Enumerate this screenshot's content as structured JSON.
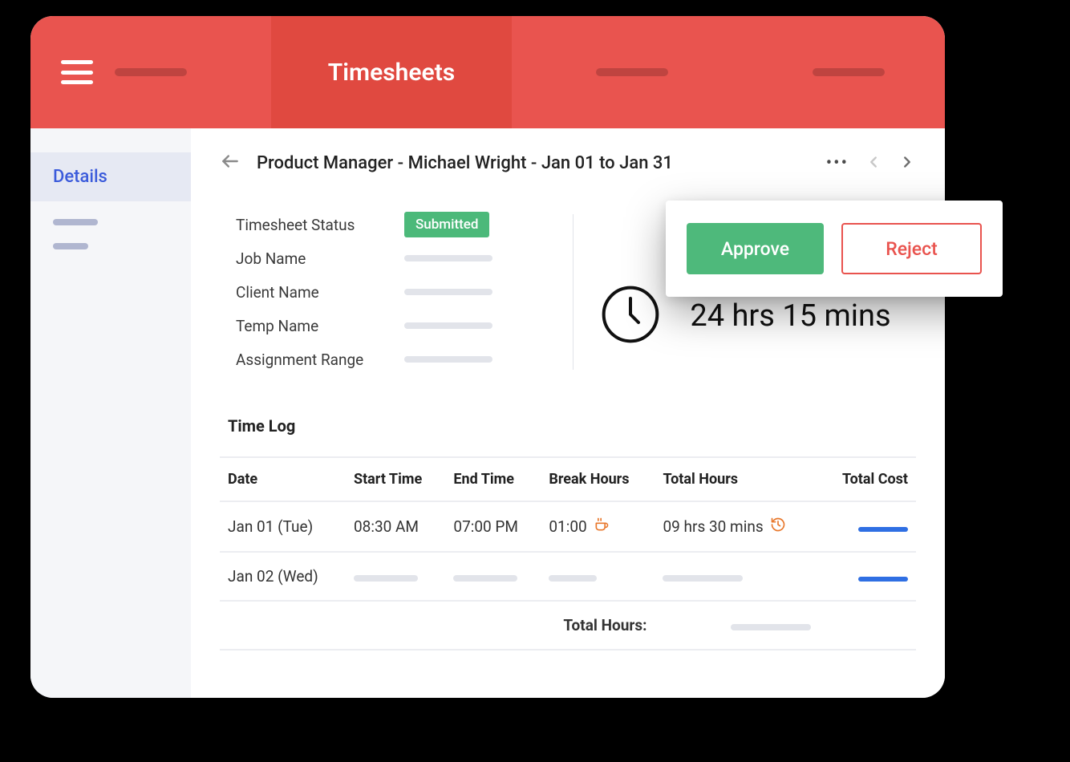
{
  "header": {
    "title": "Timesheets"
  },
  "sidebar": {
    "tab": "Details"
  },
  "toolbar": {
    "crumb": "Product Manager - Michael Wright  - Jan 01 to Jan 31"
  },
  "summary": {
    "labels": {
      "status": "Timesheet Status",
      "job": "Job Name",
      "client": "Client Name",
      "temp": "Temp Name",
      "range": "Assignment Range"
    },
    "status_value": "Submitted",
    "total_time": "24 hrs 15 mins"
  },
  "timelog": {
    "title": "Time Log",
    "columns": {
      "date": "Date",
      "start": "Start Time",
      "end": "End Time",
      "break": "Break Hours",
      "total": "Total Hours",
      "cost": "Total Cost"
    },
    "rows": [
      {
        "date": "Jan 01 (Tue)",
        "start": "08:30 AM",
        "end": "07:00 PM",
        "break": "01:00",
        "total": "09 hrs 30 mins"
      },
      {
        "date": "Jan 02 (Wed)"
      }
    ],
    "total_label": "Total Hours:"
  },
  "actions": {
    "approve": "Approve",
    "reject": "Reject"
  }
}
